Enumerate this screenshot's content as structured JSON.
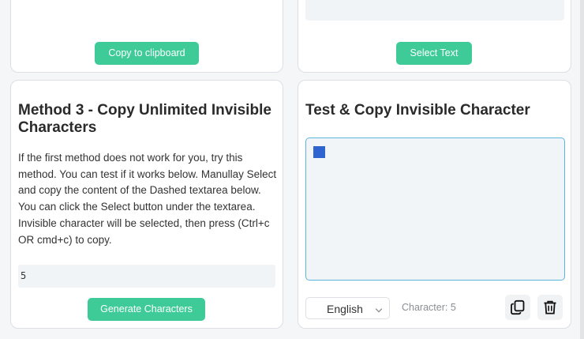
{
  "top_left": {
    "button_label": "Copy to clipboard"
  },
  "top_right": {
    "button_label": "Select Text"
  },
  "method3": {
    "title": "Method 3 - Copy Unlimited Invisible Characters",
    "description": "If the first method does not work for you, try this method. You can test if it works below. Manullay Select and copy the content of the Dashed textarea below. You can click the Select button under the textarea. Invisible character will be selected, then press (Ctrl+c OR cmd+c) to copy.",
    "field_value": "5",
    "button_label": "Generate Characters"
  },
  "test": {
    "title": "Test & Copy Invisible Character",
    "language": "English",
    "char_count": "Character: 5"
  },
  "colors": {
    "accent_green": "#3ecb97",
    "textarea_border": "#5bb5d8",
    "cursor_blue": "#2f64d0"
  },
  "icons": [
    "copy-icon",
    "trash-icon",
    "chevron-down-icon"
  ]
}
